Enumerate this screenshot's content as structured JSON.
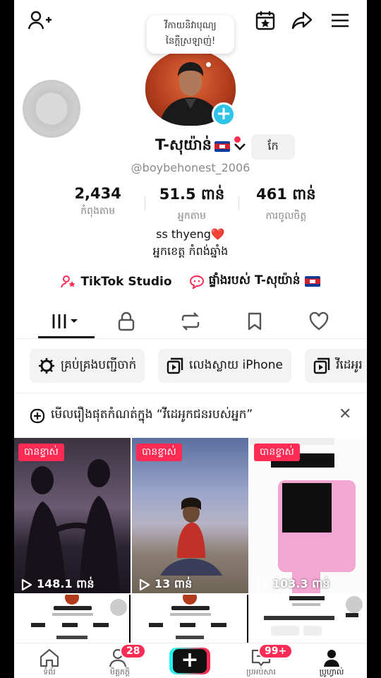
{
  "bubble": {
    "line1": "វីកាយនិវាបុណ្យ",
    "line2": "នៃក្តីស្រឡាញ់!"
  },
  "profile": {
    "name": "T-សុយ៉ាន់",
    "edit_label": "កែ",
    "handle": "@boybehonest_2006"
  },
  "stats": [
    {
      "value": "2,434",
      "label": "កំពុងតាម"
    },
    {
      "value": "51.5 ពាន់",
      "label": "អ្នកតាម"
    },
    {
      "value": "461 ពាន់",
      "label": "ការចូលចិត្ត"
    }
  ],
  "bio": {
    "line1": "ss thyeng❤️",
    "line2": "អ្នកខេត្ត កំពង់ឆ្នាំង"
  },
  "links": {
    "studio": "TikTok Studio",
    "playlist": "ផ្ទាំងរបស់ T-សុយ៉ាន់"
  },
  "chips": [
    "គ្រប់គ្រងបញ្ជីចាក់",
    "លេងស្លាយ iPhone",
    "វីដេអូរ"
  ],
  "notice": "មើលរឿងផុតកំណត់ក្នុង “វីដេអូកជនរបស់អ្នក”",
  "videos": [
    {
      "badge": "បានខ្ទាស់",
      "views": "148.1 ពាន់"
    },
    {
      "badge": "បានខ្ទាស់",
      "views": "13 ពាន់"
    },
    {
      "badge": "បានខ្ទាស់",
      "views": "103.3 ពាន់"
    }
  ],
  "nav": {
    "home": "ទំព័រ",
    "friends": "មិត្តភក្តិ",
    "friends_badge": "28",
    "inbox": "ប្រអប់សារ",
    "inbox_badge": "99+",
    "profile": "ប្រូហ្វាល់"
  },
  "colors": {
    "accent": "#fe2c55",
    "cyan": "#2ec4e8"
  }
}
